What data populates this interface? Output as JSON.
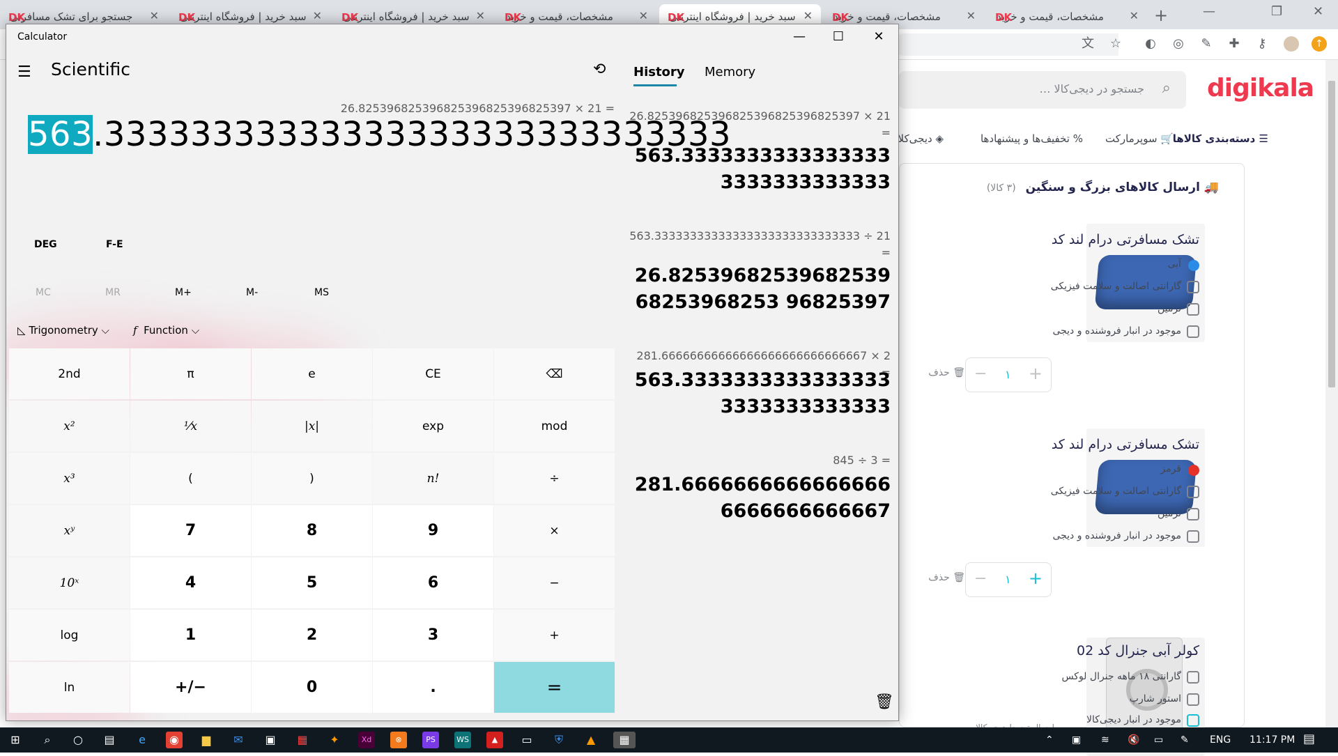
{
  "browser": {
    "tabs": [
      {
        "title": "جستجو برای تشک مسافرتی"
      },
      {
        "title": "سبد خرید | فروشگاه اینترنتی"
      },
      {
        "title": "سبد خرید | فروشگاه اینترنتی"
      },
      {
        "title": "مشخصات، قیمت و خرید"
      },
      {
        "title": "سبد خرید | فروشگاه اینترنتی"
      },
      {
        "title": "مشخصات، قیمت و خرید"
      },
      {
        "title": "مشخصات، قیمت و خرید"
      }
    ],
    "tab_logo": "DK",
    "close_glyph": "✕",
    "new_tab": "+"
  },
  "site": {
    "logo": "digikala",
    "search_placeholder": "جستجو در دیجی‌کالا …",
    "nav": {
      "categories": "دسته‌بندی کالاها",
      "supermarket": "سوپرمارکت",
      "offers": "تخفیف‌ها و پیشنهادها",
      "digiclub": "دیجی‌کلاب"
    },
    "heavy_title": "ارسال کالاهای بزرگ و سنگین",
    "heavy_count": "(۳ کالا)",
    "products": [
      {
        "title": "تشک مسافرتی درام لند کد",
        "color": "آبی",
        "color_hex": "#2a8ce6",
        "warranty": "گارانتی اصالت و سلامت فیزیکی",
        "seller": "نرمین",
        "stock": "موجود در انبار فروشنده و دیجی",
        "qty": "۱",
        "delete": "حذف"
      },
      {
        "title": "تشک مسافرتی درام لند کد",
        "color": "قرمز",
        "color_hex": "#e6312a",
        "warranty": "گارانتی اصالت و سلامت فیزیکی",
        "seller": "نرمین",
        "stock": "موجود در انبار فروشنده و دیجی",
        "qty": "۱",
        "delete": "حذف"
      },
      {
        "title": "کولر آبی جنرال کد 02",
        "warranty": "گارانتی ۱۸ ماهه جنرال لوکس",
        "seller": "استور شارپ",
        "stock": "موجود در انبار دیجی‌کالا",
        "shipping": "ارسال توسط دیجی‌کالا"
      }
    ]
  },
  "calculator": {
    "window_title": "Calculator",
    "mode": "Scientific",
    "expression": "26.825396825396825396825396825397 × 21 =",
    "display_selected": "563",
    "display_rest": ".33333333333333333333333333333",
    "deg": "DEG",
    "fe": "F-E",
    "memory_buttons": [
      "MC",
      "MR",
      "M+",
      "M-",
      "MS"
    ],
    "trig": "Trigonometry",
    "func": "Function",
    "keys": [
      [
        "2nd",
        "π",
        "e",
        "CE",
        "⌫"
      ],
      [
        "x²",
        "¹⁄x",
        "|x|",
        "exp",
        "mod"
      ],
      [
        "x³",
        "(",
        ")",
        "n!",
        "÷"
      ],
      [
        "xʸ",
        "7",
        "8",
        "9",
        "×"
      ],
      [
        "10ˣ",
        "4",
        "5",
        "6",
        "−"
      ],
      [
        "log",
        "1",
        "2",
        "3",
        "+"
      ],
      [
        "ln",
        "+/−",
        "0",
        ".",
        "="
      ]
    ],
    "history_tab": "History",
    "memory_tab": "Memory",
    "history": [
      {
        "expr": "26.825396825396825396825396825397   ×   21 =",
        "result": "563.33333333333333333333333333333"
      },
      {
        "expr": "563.33333333333333333333333333333   ÷   21 =",
        "result": "26.8253968253968253968253968253 96825397"
      },
      {
        "expr": "281.66666666666666666666666666667   ×   2 =",
        "result": "563.33333333333333333333333333333"
      },
      {
        "expr": "845   ÷   3 =",
        "result": "281.66666666666666666666666666667"
      }
    ]
  },
  "taskbar": {
    "lang": "ENG",
    "time": "11:17 PM"
  }
}
